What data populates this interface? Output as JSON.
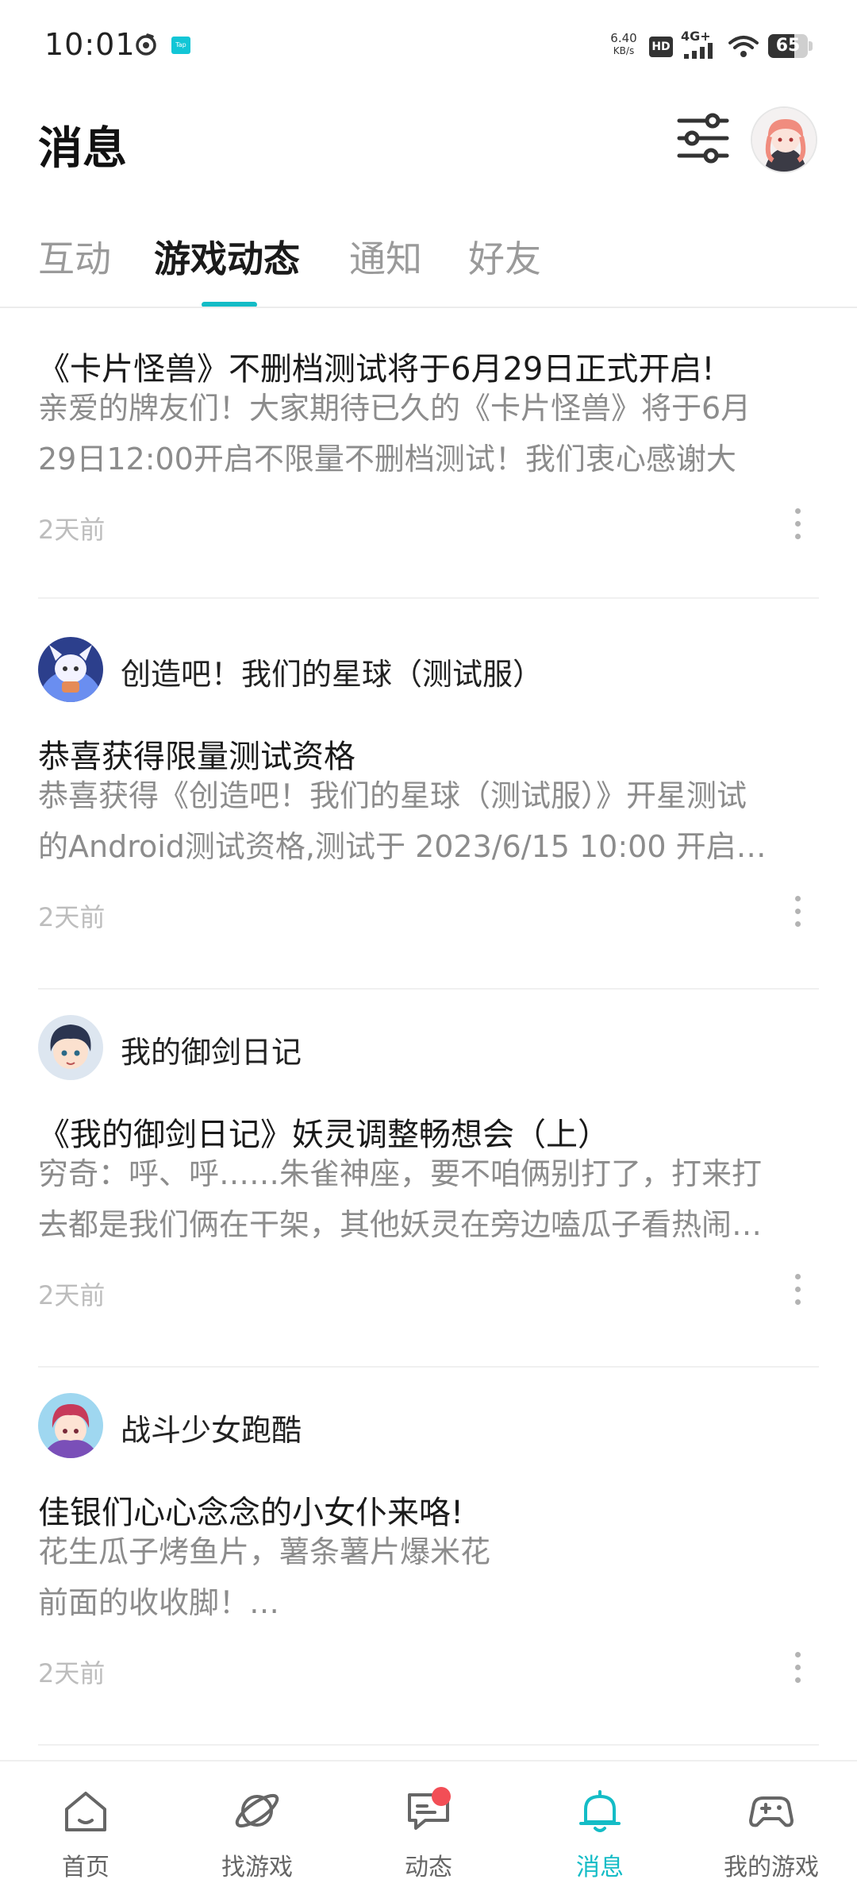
{
  "status_bar": {
    "time": "10:01",
    "speed_value": "6.40",
    "speed_unit": "KB/s",
    "hd": "HD",
    "network": "4G+",
    "battery": "65",
    "battery_level": 0.65,
    "tap_label": "Tap"
  },
  "header": {
    "title": "消息",
    "filter_icon": "filter-sliders-icon",
    "avatar_icon": "anime-girl-avatar"
  },
  "tabs": [
    {
      "label": "互动",
      "active": false
    },
    {
      "label": "游戏动态",
      "active": true
    },
    {
      "label": "通知",
      "active": false
    },
    {
      "label": "好友",
      "active": false
    }
  ],
  "feed": [
    {
      "game": "",
      "title": "《卡片怪兽》不删档测试将于6月29日正式开启!",
      "body_lines": [
        "亲爱的牌友们！大家期待已久的《卡片怪兽》将于6月",
        "29日12:00开启不限量不删档测试！我们衷心感谢大"
      ],
      "time": "2天前"
    },
    {
      "game": "创造吧！我们的星球（测试服）",
      "title": "恭喜获得限量测试资格",
      "body_lines": [
        "恭喜获得《创造吧！我们的星球（测试服）》开星测试",
        "的Android测试资格,测试于 2023/6/15 10:00 开启…"
      ],
      "time": "2天前"
    },
    {
      "game": "我的御剑日记",
      "title": "《我的御剑日记》妖灵调整畅想会（上）",
      "body_lines": [
        "穷奇：呼、呼……朱雀神座，要不咱俩别打了，打来打",
        "去都是我们俩在干架，其他妖灵在旁边嗑瓜子看热闹…"
      ],
      "time": "2天前"
    },
    {
      "game": "战斗少女跑酷",
      "title": "佳银们心心念念的小女仆来咯!",
      "body_lines": [
        "花生瓜子烤鱼片，薯条薯片爆米花",
        "前面的收收脚！…"
      ],
      "time": "2天前"
    }
  ],
  "bottom_nav": [
    {
      "label": "首页",
      "icon": "home-icon",
      "active": false
    },
    {
      "label": "找游戏",
      "icon": "planet-icon",
      "active": false
    },
    {
      "label": "动态",
      "icon": "chat-bubble-icon",
      "active": false,
      "badge": true
    },
    {
      "label": "消息",
      "icon": "bell-icon",
      "active": true
    },
    {
      "label": "我的游戏",
      "icon": "gamepad-icon",
      "active": false
    }
  ],
  "colors": {
    "accent": "#14bcc6",
    "badge": "#f24e56",
    "muted_text": "#8c8c8c",
    "time_text": "#bdbdbd"
  }
}
